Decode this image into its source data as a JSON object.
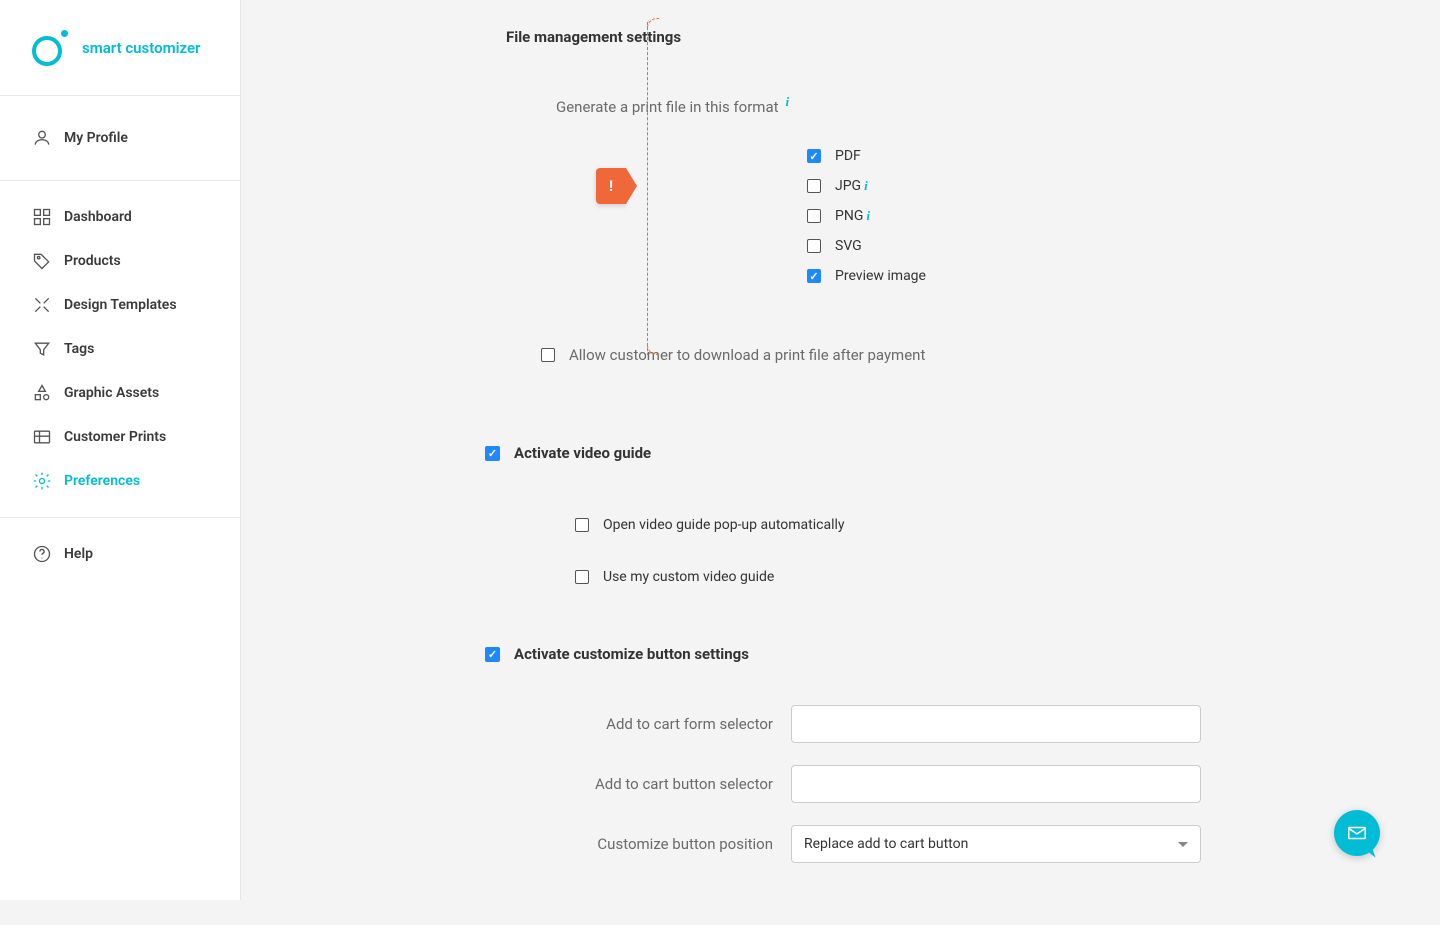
{
  "brand": "smart customizer",
  "sidebar": {
    "profile": "My Profile",
    "items": [
      {
        "label": "Dashboard"
      },
      {
        "label": "Products"
      },
      {
        "label": "Design Templates"
      },
      {
        "label": "Tags"
      },
      {
        "label": "Graphic Assets"
      },
      {
        "label": "Customer Prints"
      },
      {
        "label": "Preferences"
      }
    ],
    "help": "Help"
  },
  "section": {
    "title": "File management settings",
    "subhead": "Generate a print file in this format",
    "formats": [
      {
        "label": "PDF",
        "checked": true,
        "info": false
      },
      {
        "label": "JPG",
        "checked": false,
        "info": true
      },
      {
        "label": "PNG",
        "checked": false,
        "info": true
      },
      {
        "label": "SVG",
        "checked": false,
        "info": false
      },
      {
        "label": "Preview image",
        "checked": true,
        "info": false
      }
    ],
    "allow_download": "Allow customer to download a print file after payment"
  },
  "video": {
    "activate": "Activate video guide",
    "open_auto": "Open video guide pop-up automatically",
    "custom": "Use my custom video guide"
  },
  "customize": {
    "activate": "Activate customize button settings",
    "form_selector": "Add to cart form selector",
    "button_selector": "Add to cart button selector",
    "position_label": "Customize button position",
    "position_value": "Replace add to cart button"
  },
  "alert": "!"
}
